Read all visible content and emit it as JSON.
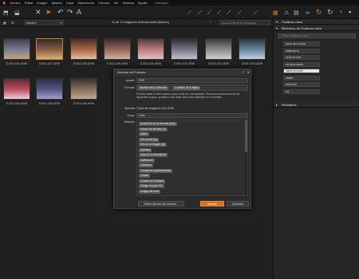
{
  "menu": [
    "Archivo",
    "Editar",
    "Imagen",
    "Ajustes",
    "Capa",
    "Seleccionar",
    "Cámara",
    "Ver",
    "Ventana",
    "Ayuda"
  ],
  "window_title": "Catálogo1",
  "filter": {
    "sort_value": "Nombre",
    "count_text": "11 de 11 imágenes seleccionadas (filtrado)",
    "search_placeholder": "Buscar Filtros de búsqueda"
  },
  "thumbnails": [
    {
      "name": "D1001-026.ARW",
      "selected": false
    },
    {
      "name": "D1001-027.ARW",
      "selected": true
    },
    {
      "name": "D1001-028.ARW",
      "selected": false
    },
    {
      "name": "D1001-029.ARW",
      "selected": false
    },
    {
      "name": "D1001-030.ARW",
      "selected": false
    },
    {
      "name": "D1001-031.ARW",
      "selected": false
    },
    {
      "name": "D1001-032.ARW",
      "selected": false
    },
    {
      "name": "D1001-033.ARW",
      "selected": false
    },
    {
      "name": "D1001-034.ARW",
      "selected": false
    },
    {
      "name": "D1001-035.ARW",
      "selected": false
    },
    {
      "name": "D1001-036.ARW",
      "selected": false
    }
  ],
  "right_panel": {
    "palabras_clave": "Palabras clave",
    "biblioteca": "Biblioteca de Palabras clave",
    "search_placeholder": "Filtrar Palabras clave",
    "keywords": [
      "picos de europa",
      "salamanca",
      "seda de mar",
      "semana santa",
      "steve mccurry",
      "vfdsfa",
      "wfca foto",
      "xvl"
    ],
    "highlighted": "steve mccurry",
    "metadatos": "Metadatos"
  },
  "dialog": {
    "title": "Nombre de Formato",
    "ajustes_label": "Ajustes",
    "ajustes_value": "PSP",
    "formato_label": "Formato",
    "formato_tags": [
      "Nombre de la Colección",
      "Contador de 3 dígitos"
    ],
    "description": "Puedes editar el texto anterior para cubrir tus necesidades. Selecciona elementos de los siguientes grupos, arrastra o haz doble click para añadirlos en el formato.",
    "muestra_label": "Muestra",
    "muestra_value": "Todas las imágenes-001.ARW",
    "grupo_label": "Grupo",
    "grupo_value": "Todo",
    "atributos_label": "Atributos",
    "atributos": [
      "Actual Día de la Semana (ddd)",
      "Actual Día del Mes (d)",
      "Altitud",
      "Año Actual (yy)",
      "Año de la Imagen (yy)",
      "Apertura",
      "Autor de la descripción",
      "Calificación",
      "Categoría",
      "Categorías suplementarias",
      "Ciudad",
      "Ciudad de la Imagen",
      "Código de país ISO",
      "Código del tema"
    ],
    "save_button": "Salvar Ajustes del usuario...",
    "accept_button": "Aceptar",
    "cancel_button": "Cancelar"
  }
}
